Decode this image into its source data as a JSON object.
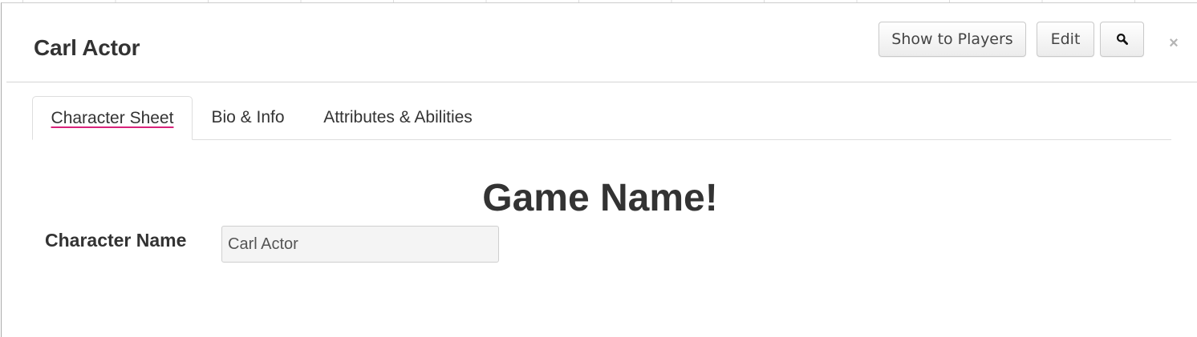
{
  "dialog": {
    "title": "Carl Actor",
    "buttons": {
      "show_to_players": "Show to Players",
      "edit": "Edit",
      "search_icon": "magnifier-icon"
    },
    "close_icon": "close-icon",
    "close_glyph": "×"
  },
  "tabs": [
    {
      "label": "Character Sheet",
      "active": true
    },
    {
      "label": "Bio & Info",
      "active": false
    },
    {
      "label": "Attributes & Abilities",
      "active": false
    }
  ],
  "sheet": {
    "heading": "Game Name!",
    "character_name_label": "Character Name",
    "character_name_value": "Carl Actor"
  },
  "colors": {
    "active_tab_underline": "#d8237a",
    "text": "#333333",
    "input_bg": "#f4f4f4"
  }
}
